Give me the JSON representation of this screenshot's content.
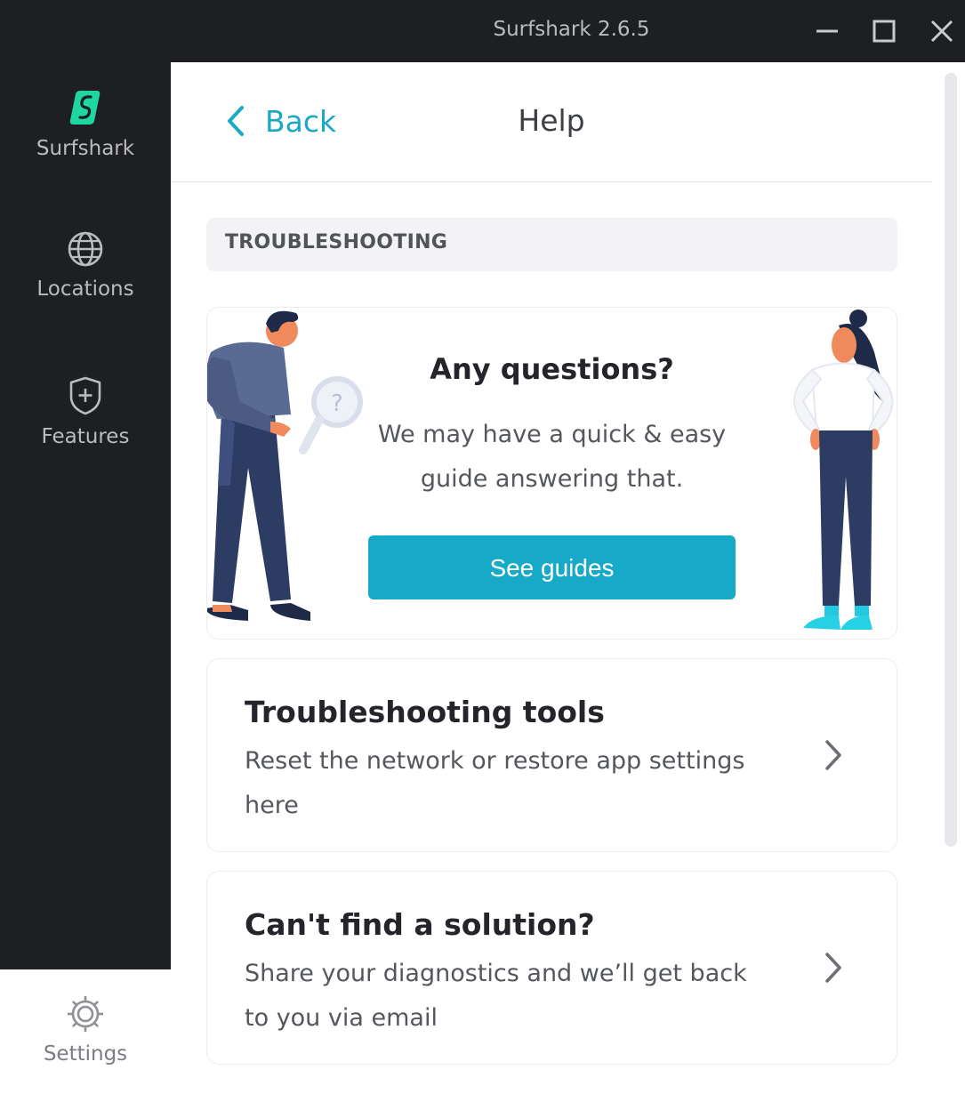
{
  "window": {
    "title": "Surfshark 2.6.5",
    "controls": [
      "minimize-icon",
      "maximize-icon",
      "close-icon"
    ]
  },
  "sidebar": {
    "items": [
      {
        "label": "Surfshark",
        "icon": "surfshark-logo-icon"
      },
      {
        "label": "Locations",
        "icon": "globe-icon"
      },
      {
        "label": "Features",
        "icon": "shield-plus-icon"
      }
    ],
    "settings": {
      "label": "Settings",
      "icon": "gear-icon"
    }
  },
  "header": {
    "back_label": "Back",
    "title": "Help"
  },
  "section": {
    "label": "TROUBLESHOOTING"
  },
  "promo": {
    "title": "Any questions?",
    "description": "We may have a quick & easy guide answering that.",
    "button_label": "See guides",
    "illustrations": [
      "man-with-magnifier-illustration",
      "woman-standing-illustration"
    ]
  },
  "cards": [
    {
      "title": "Troubleshooting tools",
      "description": "Reset the network or restore app settings here",
      "icon": "chevron-right-icon"
    },
    {
      "title": "Can't find a solution?",
      "description": "Share your diagnostics and we’ll get back to you via email",
      "icon": "chevron-right-icon"
    }
  ],
  "colors": {
    "accent": "#17aac8",
    "logo_green": "#1fd6a0",
    "sidebar_bg": "#1e1f23"
  }
}
